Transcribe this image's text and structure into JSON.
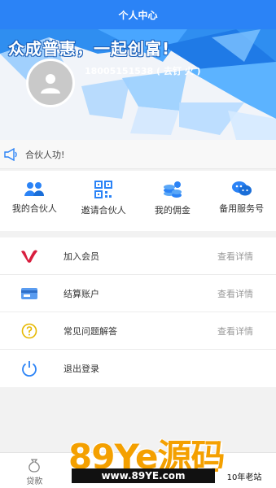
{
  "header": {
    "title": "个人中心"
  },
  "banner": {
    "slogan": "众成普惠，一起创富!",
    "phone": "18005151538 ( 去钉 火 )"
  },
  "notice": {
    "text": "合伙人功!",
    "icon": "megaphone-icon"
  },
  "quick_links": [
    {
      "label": "我的合伙人",
      "icon": "partners-icon"
    },
    {
      "label": "邀请合伙人",
      "icon": "qrcode-icon"
    },
    {
      "label": "我的佣金",
      "icon": "coins-icon"
    },
    {
      "label": "备用服务号",
      "icon": "wechat-icon"
    }
  ],
  "menu": [
    {
      "label": "加入会员",
      "more": "查看详情",
      "icon": "vip-v-icon"
    },
    {
      "label": "结算账户",
      "more": "查看详情",
      "icon": "card-icon"
    },
    {
      "label": "常见问题解答",
      "more": "查看详情",
      "icon": "question-icon"
    },
    {
      "label": "退出登录",
      "more": "",
      "icon": "power-icon"
    }
  ],
  "tabbar": [
    {
      "label": "贷款"
    },
    {
      "label": ""
    },
    {
      "label": ""
    },
    {
      "label": ""
    }
  ],
  "watermark": {
    "logo": "89Ye源码",
    "url": "www.89YE.com",
    "tag": "10年老站"
  },
  "colors": {
    "primary": "#2b83f6",
    "watermark": "#f4a000"
  }
}
